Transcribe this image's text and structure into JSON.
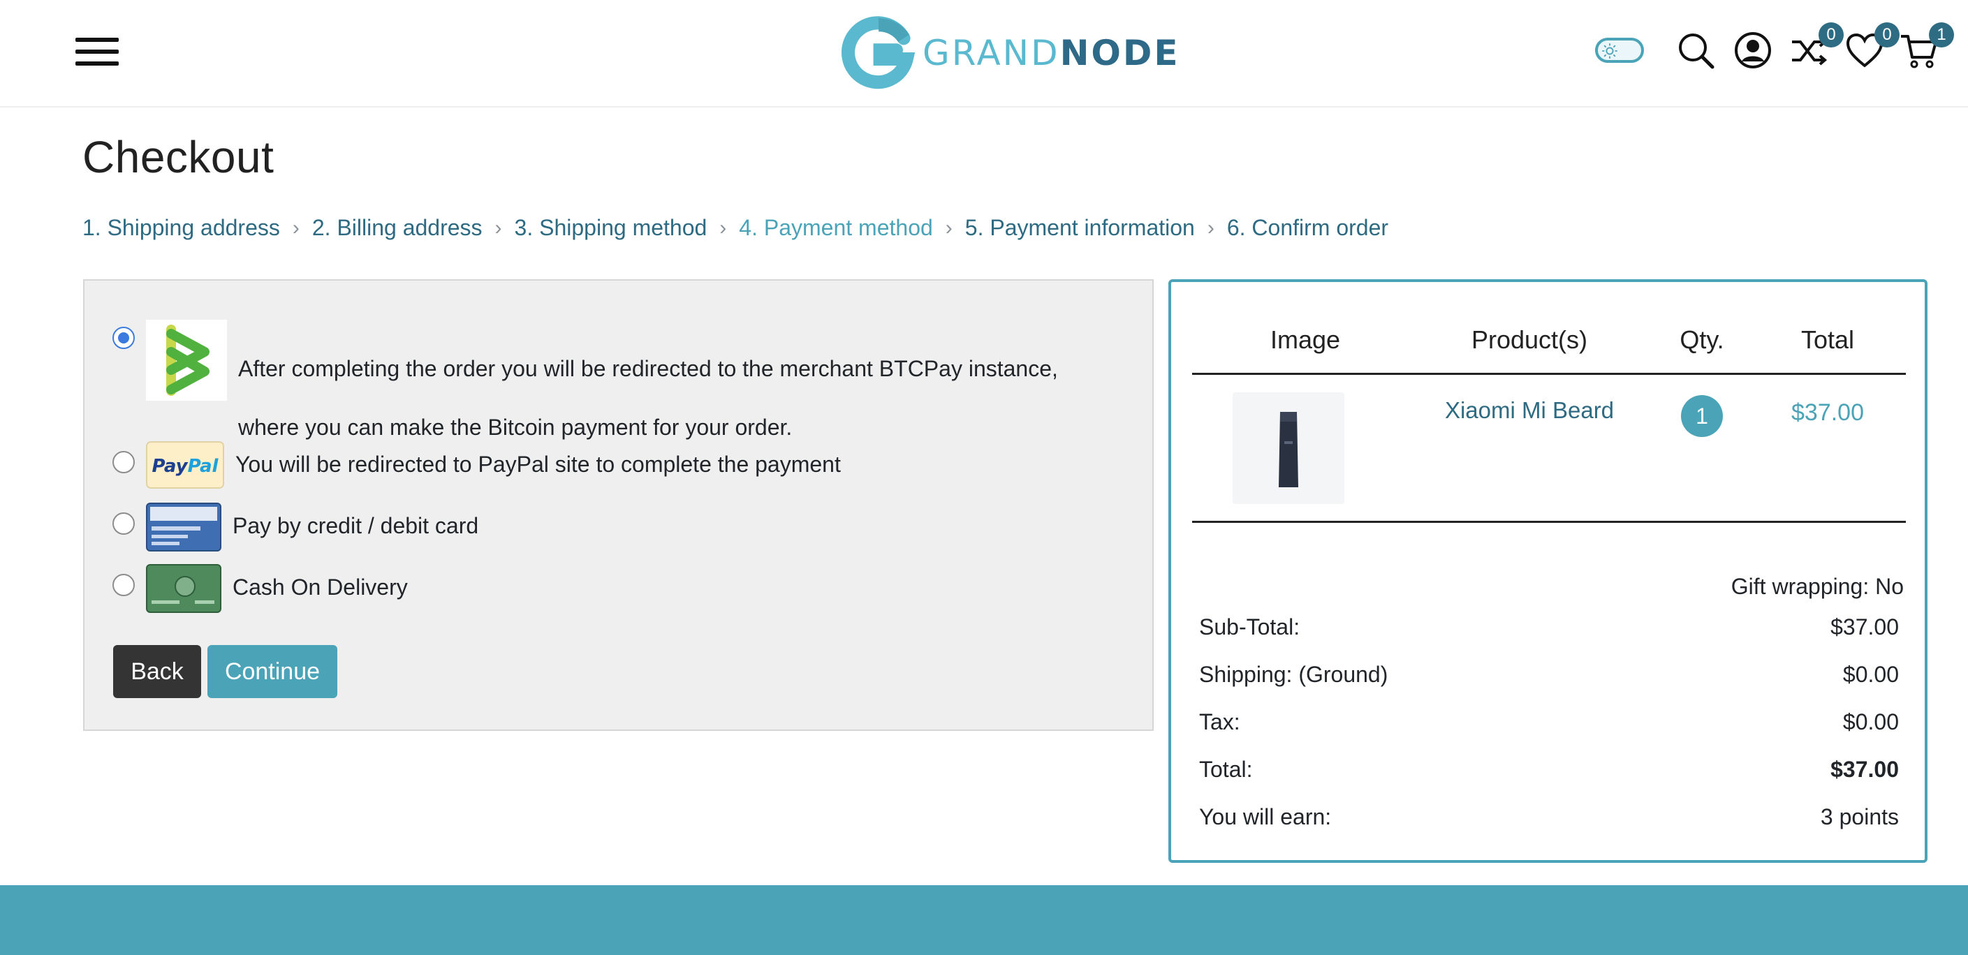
{
  "header": {
    "logo": {
      "text_a": "GRAND",
      "text_b": "NODE"
    },
    "icons": [
      "hamburger-menu-icon",
      "theme-toggle",
      "search-icon",
      "account-icon",
      "compare-icon",
      "wishlist-icon",
      "cart-icon"
    ],
    "compare_count": "0",
    "wishlist_count": "0",
    "cart_count": "1"
  },
  "page": {
    "title": "Checkout"
  },
  "steps": [
    {
      "label": "1. Shipping address"
    },
    {
      "label": "2. Billing address"
    },
    {
      "label": "3. Shipping method"
    },
    {
      "label": "4. Payment method",
      "active": true
    },
    {
      "label": "5. Payment information"
    },
    {
      "label": "6. Confirm order"
    }
  ],
  "payment_methods": [
    {
      "text": "After completing the order you will be redirected to the merchant BTCPay instance, where you can make the Bitcoin payment for your order.",
      "selected": true,
      "logo": "btcpay-logo"
    },
    {
      "text": "You will be redirected to PayPal site to complete the payment",
      "selected": false,
      "logo": "paypal-logo"
    },
    {
      "text": "Pay by credit / debit card",
      "selected": false,
      "logo": "credit-card-logo"
    },
    {
      "text": "Cash On Delivery",
      "selected": false,
      "logo": "cash-card-logo"
    }
  ],
  "buttons": {
    "back": "Back",
    "continue": "Continue"
  },
  "order": {
    "columns": [
      "Image",
      "Product(s)",
      "Qty.",
      "Total"
    ],
    "items": [
      {
        "name": "Xiaomi Mi Beard",
        "qty": "1",
        "total": "$37.00"
      }
    ],
    "gift_wrapping": "Gift wrapping: No",
    "totals": [
      {
        "label": "Sub-Total:",
        "value": "$37.00"
      },
      {
        "label": "Shipping: (Ground)",
        "value": "$0.00"
      },
      {
        "label": "Tax:",
        "value": "$0.00"
      },
      {
        "label": "Total:",
        "value": "$37.00",
        "bold": true
      },
      {
        "label": "You will earn:",
        "value": "3 points"
      }
    ]
  },
  "colors": {
    "accent": "#4ba3b8",
    "link": "#2e6a82",
    "dark_button": "#343434",
    "radio_selected": "#3b7be0"
  }
}
